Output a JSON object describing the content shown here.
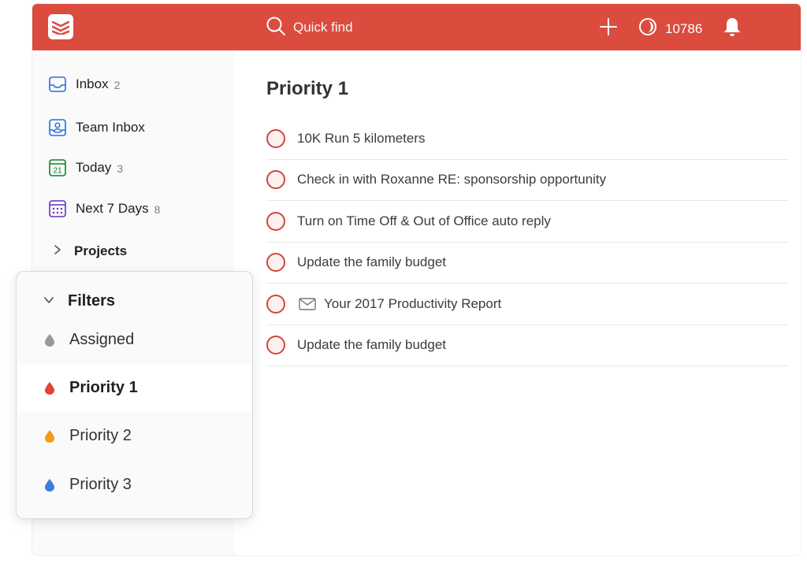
{
  "topbar": {
    "quick_find_label": "Quick find",
    "karma_count": "10786",
    "accent_color": "#db4c3f"
  },
  "sidebar": {
    "items": [
      {
        "label": "Inbox",
        "count": "2",
        "icon": "inbox-icon"
      },
      {
        "label": "Team Inbox",
        "count": "",
        "icon": "team-inbox-icon"
      },
      {
        "label": "Today",
        "count": "3",
        "icon": "calendar-today-icon",
        "day": "21"
      },
      {
        "label": "Next 7 Days",
        "count": "8",
        "icon": "calendar-week-icon"
      }
    ],
    "projects_label": "Projects"
  },
  "filters": {
    "heading": "Filters",
    "items": [
      {
        "label": "Assigned",
        "color": "#999999"
      },
      {
        "label": "Priority 1",
        "color": "#e44232",
        "active": true
      },
      {
        "label": "Priority 2",
        "color": "#f49c18"
      },
      {
        "label": "Priority 3",
        "color": "#3d7de0"
      }
    ]
  },
  "main": {
    "title": "Priority 1",
    "tasks": [
      {
        "text": "10K Run 5 kilometers"
      },
      {
        "text": "Check in with Roxanne RE: sponsorship opportunity"
      },
      {
        "text": "Turn on Time Off & Out of Office auto reply"
      },
      {
        "text": "Update the family budget"
      },
      {
        "text": "Your 2017 Productivity Report",
        "icon": "mail-icon"
      },
      {
        "text": "Update the family budget"
      }
    ]
  }
}
